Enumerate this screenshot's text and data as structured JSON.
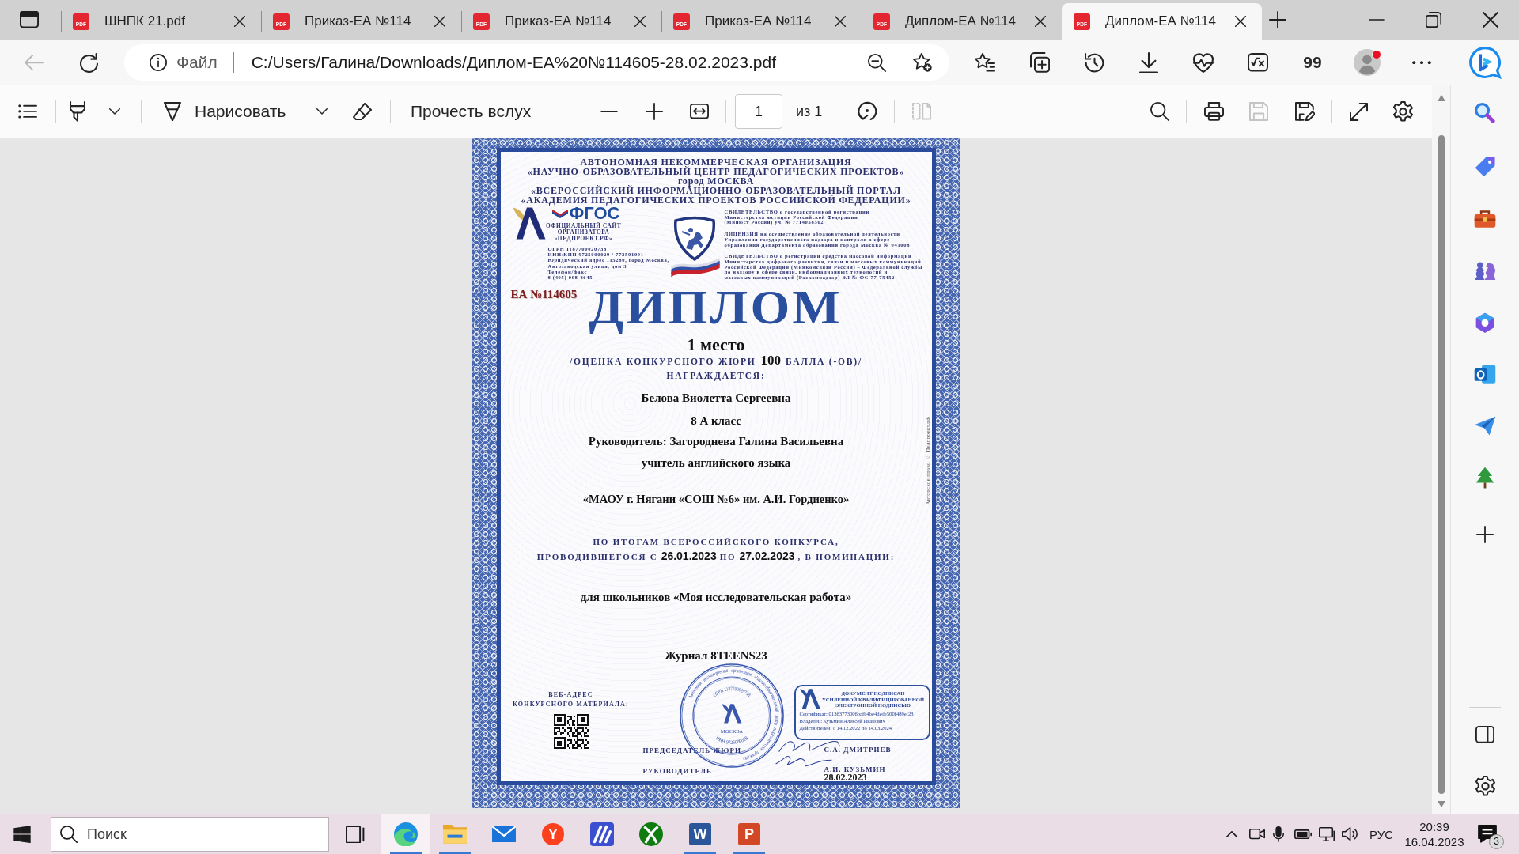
{
  "tab_strip": {
    "tabs": [
      {
        "icon_label": "PDF",
        "label": "ШНПК 21.pdf",
        "selected": false
      },
      {
        "icon_label": "PDF",
        "label": "Приказ-ЕА №114",
        "selected": false
      },
      {
        "icon_label": "PDF",
        "label": "Приказ-ЕА №114",
        "selected": false
      },
      {
        "icon_label": "PDF",
        "label": "Приказ-ЕА №114",
        "selected": false
      },
      {
        "icon_label": "PDF",
        "label": "Диплом-ЕА №114",
        "selected": false
      },
      {
        "icon_label": "PDF",
        "label": "Диплом-ЕА №114",
        "selected": true
      }
    ]
  },
  "address_bar": {
    "back": {
      "disabled": true
    },
    "scheme": "Файл",
    "url": "C:/Users/Галина/Downloads/Диплом-ЕА%20№114605-28.02.2023.pdf",
    "extension_label": "99",
    "profile": {
      "notification": true
    }
  },
  "pdf_toolbar": {
    "draw_label": "Нарисовать",
    "read_aloud_label": "Прочесть вслух",
    "page_field": {
      "value": "1"
    },
    "page_count": "из 1",
    "two_page_view": {
      "disabled": true
    },
    "save": {
      "disabled": true
    }
  },
  "document": {
    "header_lines": [
      "АВТОНОМНАЯ НЕКОММЕРЧЕСКАЯ ОРГАНИЗАЦИЯ",
      "«НАУЧНО-ОБРАЗОВАТЕЛЬНЫЙ ЦЕНТР ПЕДАГОГИЧЕСКИХ ПРОЕКТОВ»",
      "город МОСКВА",
      "«ВСЕРОССИЙСКИЙ ИНФОРМАЦИОННО-ОБРАЗОВАТЕЛЬНЫЙ ПОРТАЛ",
      "«АКАДЕМИЯ ПЕДАГОГИЧЕСКИХ ПРОЕКТОВ РОССИЙСКОЙ ФЕДЕРАЦИИ»"
    ],
    "standard_mark": "ФГОС",
    "site_caption": [
      "ОФИЦИАЛЬНЫЙ САЙТ",
      "ОРГАНИЗАТОРА",
      "«ПЕДПРОЕКТ.РФ»"
    ],
    "organizer_details": [
      "ОГРН 1187700020738",
      "ИНН/КПП 9725000029 / 772501001",
      "Юридический адрес 115280, город Москва,",
      "Автозаводская улица, дом 3",
      "Телефон/факс",
      "8 (495) 008-8645"
    ],
    "registrations": [
      {
        "lines": [
          "СВИДЕТЕЛЬСТВО о государственной регистрации",
          "Министерства юстиции Российской Федерации",
          "(Минюст России) уч. № 7714058502"
        ]
      },
      {
        "lines": [
          "ЛИЦЕНЗИЯ на осуществление образовательной деятельности",
          "Управления государственного надзора и контроля в сфере",
          "образования Департамента образования города Москва № 041008"
        ]
      },
      {
        "lines": [
          "СВИДЕТЕЛЬСТВО о регистрации средства массовой информации",
          "Министерства цифрового развития, связи и массовых коммуникаций",
          "Российской Федерации (Минкомсвязи России) – Федеральной службы",
          "по надзору в сфере связи, информационных технологий и",
          "массовых коммуникаций (Роскомнадзор) ЭЛ № ФС 77-75452"
        ]
      }
    ],
    "number": "ЕА №114605",
    "title": "ДИПЛОМ",
    "place": "1 место",
    "score": [
      {
        "kind": "label",
        "text": "/ОЦЕНКА КОНКУРСНОГО ЖЮРИ"
      },
      {
        "kind": "value",
        "text": "100"
      },
      {
        "kind": "label",
        "text": "БАЛЛА (-ОВ)/"
      }
    ],
    "awarded_label": "НАГРАЖДАЕТСЯ:",
    "recipient_lines": [
      "Белова Виолетта Сергеевна",
      "8 А класс",
      "Руководитель: Загороднева Галина Васильевна",
      "учитель английского языка"
    ],
    "school": "«МАОУ г. Нягани «СОШ №6» им. А.И. Гордиенко»",
    "contest_lines": [
      {
        "segments": [
          {
            "kind": "label",
            "text": "ПО ИТОГАМ ВСЕРОССИЙСКОГО КОНКУРСА,"
          }
        ]
      },
      {
        "segments": [
          {
            "kind": "label",
            "text": "ПРОВОДИВШЕГОСЯ С"
          },
          {
            "kind": "value",
            "text": "26.01.2023"
          },
          {
            "kind": "label",
            "text": "ПО"
          },
          {
            "kind": "value",
            "text": "27.02.2023"
          },
          {
            "kind": "label",
            "text": ", В НОМИНАЦИИ:"
          }
        ]
      }
    ],
    "nomination": "для школьников «Моя исследовательская работа»",
    "journal": "Журнал 8TEENS23",
    "material_caption": [
      "ВЕБ-АДРЕС",
      "КОНКУРСНОГО МАТЕРИАЛА:"
    ],
    "signatory_roles": [
      "ПРЕДСЕДАТЕЛЬ ЖЮРИ",
      "РУКОВОДИТЕЛЬ"
    ],
    "e_signature": {
      "heading_lines": [
        "ДОКУМЕНТ ПОДПИСАН",
        "УСИЛЕННОЙ КВАЛИФИЦИРОВАННОЙ",
        "ЭЛЕКТРОННОЙ ПОДПИСЬЮ"
      ],
      "detail_lines": [
        "Сертификат: 01363773006bafb4be4dede500f489ef23",
        "Владелец: Кузьмин Алексей Иванович",
        "Действителен: с 14.12.2022 по 14.03.2024"
      ]
    },
    "signatory_names": [
      "С.А. ДМИТРИЕВ",
      "А.И. КУЗЬМИН"
    ],
    "date": "28.02.2023",
    "stamp": {
      "ring_words": [
        "Автономная",
        "некоммерческая",
        "организация",
        "«Научно-образовательный",
        "центр",
        "педагогических",
        "проектов»"
      ],
      "top_text": "ОГРН 1187700020738",
      "bottom_text": "ИНН 9725000029",
      "city": "·МОСКВА·"
    },
    "copyright": "Авторское право © Педпроект.рф"
  },
  "taskbar": {
    "search": {
      "placeholder": "Поиск"
    },
    "apps": [
      {
        "running": true,
        "selected": true
      },
      {
        "running": true,
        "selected": false
      },
      {
        "running": false,
        "selected": false
      },
      {
        "glyph": "Y",
        "running": false,
        "selected": false
      },
      {
        "running": false,
        "selected": false
      },
      {
        "running": false,
        "selected": false
      },
      {
        "glyph": "W",
        "running": true,
        "selected": false
      },
      {
        "glyph": "P",
        "running": true,
        "selected": false
      }
    ],
    "language": "РУС",
    "time": "20:39",
    "date": "16.04.2023",
    "notifications": "3"
  }
}
